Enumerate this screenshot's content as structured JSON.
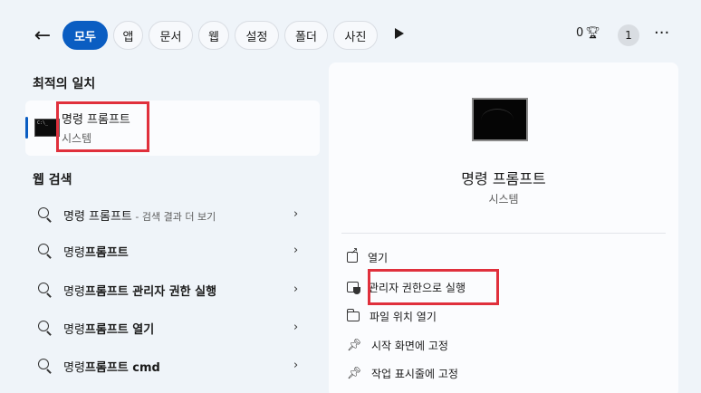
{
  "filters": {
    "chips": [
      {
        "label": "모두",
        "active": true
      },
      {
        "label": "앱",
        "active": false
      },
      {
        "label": "문서",
        "active": false
      },
      {
        "label": "웹",
        "active": false
      },
      {
        "label": "설정",
        "active": false
      },
      {
        "label": "폴더",
        "active": false
      },
      {
        "label": "사진",
        "active": false
      }
    ],
    "points": "0",
    "avatar_initial": "1",
    "more": "···"
  },
  "best_match": {
    "section_title": "최적의 일치",
    "name": "명령 프롬프트",
    "type": "시스템"
  },
  "web_search": {
    "section_title": "웹 검색",
    "items": [
      {
        "plain": "명령 프롬프트",
        "bold": "",
        "sub": " - 검색 결과 더 보기"
      },
      {
        "plain": "명령",
        "bold": "프롬프트",
        "sub": ""
      },
      {
        "plain": "명령",
        "bold": "프롬프트 관리자 권한 실행",
        "sub": ""
      },
      {
        "plain": "명령",
        "bold": "프롬프트 열기",
        "sub": ""
      },
      {
        "plain": "명령",
        "bold": "프롬프트 cmd",
        "sub": ""
      }
    ]
  },
  "preview": {
    "title": "명령 프롬프트",
    "subtitle": "시스템",
    "actions": [
      {
        "label": "열기",
        "icon": "open-icon"
      },
      {
        "label": "관리자 권한으로 실행",
        "icon": "admin-shield-icon"
      },
      {
        "label": "파일 위치 열기",
        "icon": "folder-icon"
      },
      {
        "label": "시작 화면에 고정",
        "icon": "pin-icon"
      },
      {
        "label": "작업 표시줄에 고정",
        "icon": "pin-icon"
      }
    ]
  },
  "colors": {
    "accent": "#0a5dc2",
    "highlight_box": "#e0303c",
    "background": "#eff4f9"
  }
}
